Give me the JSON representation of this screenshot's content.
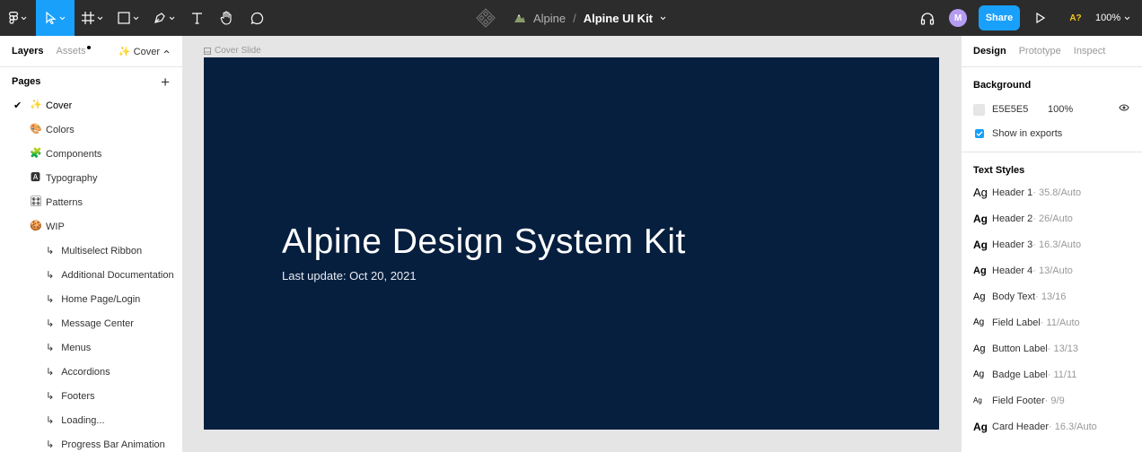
{
  "toolbar": {
    "breadcrumb": {
      "team": "Alpine",
      "separator": "/",
      "file": "Alpine UI Kit"
    },
    "avatar_initial": "M",
    "share_label": "Share",
    "a11y_label": "A?",
    "zoom_label": "100%"
  },
  "left_panel": {
    "tabs": {
      "layers": "Layers",
      "assets": "Assets"
    },
    "current_page": "✨ Cover",
    "pages_title": "Pages",
    "add_page": "+",
    "pages": [
      {
        "emoji": "✨",
        "label": "Cover",
        "active": true
      },
      {
        "emoji": "🎨",
        "label": "Colors"
      },
      {
        "emoji": "🧩",
        "label": "Components"
      },
      {
        "emoji": "🅰",
        "label": "Typography"
      },
      {
        "emoji": "🎛",
        "label": "Patterns"
      },
      {
        "emoji": "🍪",
        "label": "WIP"
      }
    ],
    "sub_pages": [
      "Multiselect Ribbon",
      "Additional Documentation",
      "Home Page/Login",
      "Message Center",
      "Menus",
      "Accordions",
      "Footers",
      "Loading...",
      "Progress Bar Animation"
    ],
    "sub_arrow": "↳"
  },
  "canvas": {
    "frame_label": "Cover Slide",
    "title": "Alpine Design System Kit",
    "subtitle": "Last update: Oct 20, 2021"
  },
  "right_panel": {
    "tabs": {
      "design": "Design",
      "prototype": "Prototype",
      "inspect": "Inspect"
    },
    "background_title": "Background",
    "background_hex": "E5E5E5",
    "background_opacity": "100%",
    "show_in_exports": "Show in exports",
    "text_styles_title": "Text Styles",
    "text_styles": [
      {
        "name": "Header 1",
        "spec": " · 35.8/Auto"
      },
      {
        "name": "Header 2",
        "spec": " · 26/Auto"
      },
      {
        "name": "Header 3",
        "spec": " · 16.3/Auto"
      },
      {
        "name": "Header 4",
        "spec": " · 13/Auto"
      },
      {
        "name": "Body Text",
        "spec": " · 13/16"
      },
      {
        "name": "Field Label",
        "spec": " · 11/Auto"
      },
      {
        "name": "Button Label",
        "spec": " · 13/13"
      },
      {
        "name": "Badge Label",
        "spec": " · 11/11"
      },
      {
        "name": "Field Footer",
        "spec": " · 9/9"
      },
      {
        "name": "Card Header",
        "spec": " · 16.3/Auto"
      }
    ],
    "ag_glyph": "Ag"
  },
  "colors": {
    "accent": "#18a0fb",
    "toolbar": "#2c2c2c",
    "frame": "#071f3e",
    "canvas": "#e5e5e5"
  }
}
